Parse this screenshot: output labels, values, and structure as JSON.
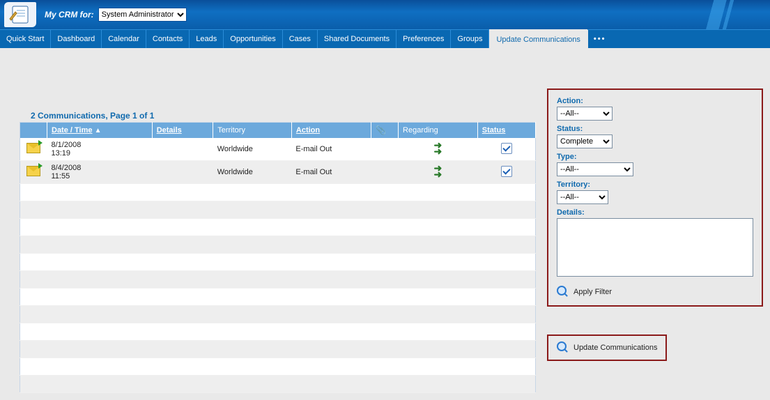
{
  "header": {
    "mycrm_label": "My CRM for:",
    "user_dropdown_value": "System Administrator"
  },
  "tabs": [
    {
      "label": "Quick Start",
      "active": false
    },
    {
      "label": "Dashboard",
      "active": false
    },
    {
      "label": "Calendar",
      "active": false
    },
    {
      "label": "Contacts",
      "active": false
    },
    {
      "label": "Leads",
      "active": false
    },
    {
      "label": "Opportunities",
      "active": false
    },
    {
      "label": "Cases",
      "active": false
    },
    {
      "label": "Shared Documents",
      "active": false
    },
    {
      "label": "Preferences",
      "active": false
    },
    {
      "label": "Groups",
      "active": false
    },
    {
      "label": "Update Communications",
      "active": true
    }
  ],
  "grid": {
    "title": "2 Communications, Page 1 of 1",
    "columns": {
      "datetime": "Date / Time",
      "details": "Details",
      "territory": "Territory",
      "action": "Action",
      "attachment": "📎",
      "regarding": "Regarding",
      "status": "Status"
    },
    "rows": [
      {
        "icon": "email-out",
        "date": "8/1/2008",
        "time": "13:19",
        "details": "",
        "territory": "Worldwide",
        "action": "E-mail Out",
        "attachment": "",
        "regarding_icon": "arrows",
        "status_checked": true,
        "alt": false
      },
      {
        "icon": "email-out",
        "date": "8/4/2008",
        "time": "11:55",
        "details": "",
        "territory": "Worldwide",
        "action": "E-mail Out",
        "attachment": "",
        "regarding_icon": "arrows",
        "status_checked": true,
        "alt": true
      }
    ]
  },
  "filter": {
    "action_label": "Action:",
    "action_value": "--All--",
    "status_label": "Status:",
    "status_value": "Complete",
    "type_label": "Type:",
    "type_value": "--All--",
    "territory_label": "Territory:",
    "territory_value": "--All--",
    "details_label": "Details:",
    "details_value": "",
    "apply_label": "Apply Filter"
  },
  "update_button_label": "Update Communications"
}
